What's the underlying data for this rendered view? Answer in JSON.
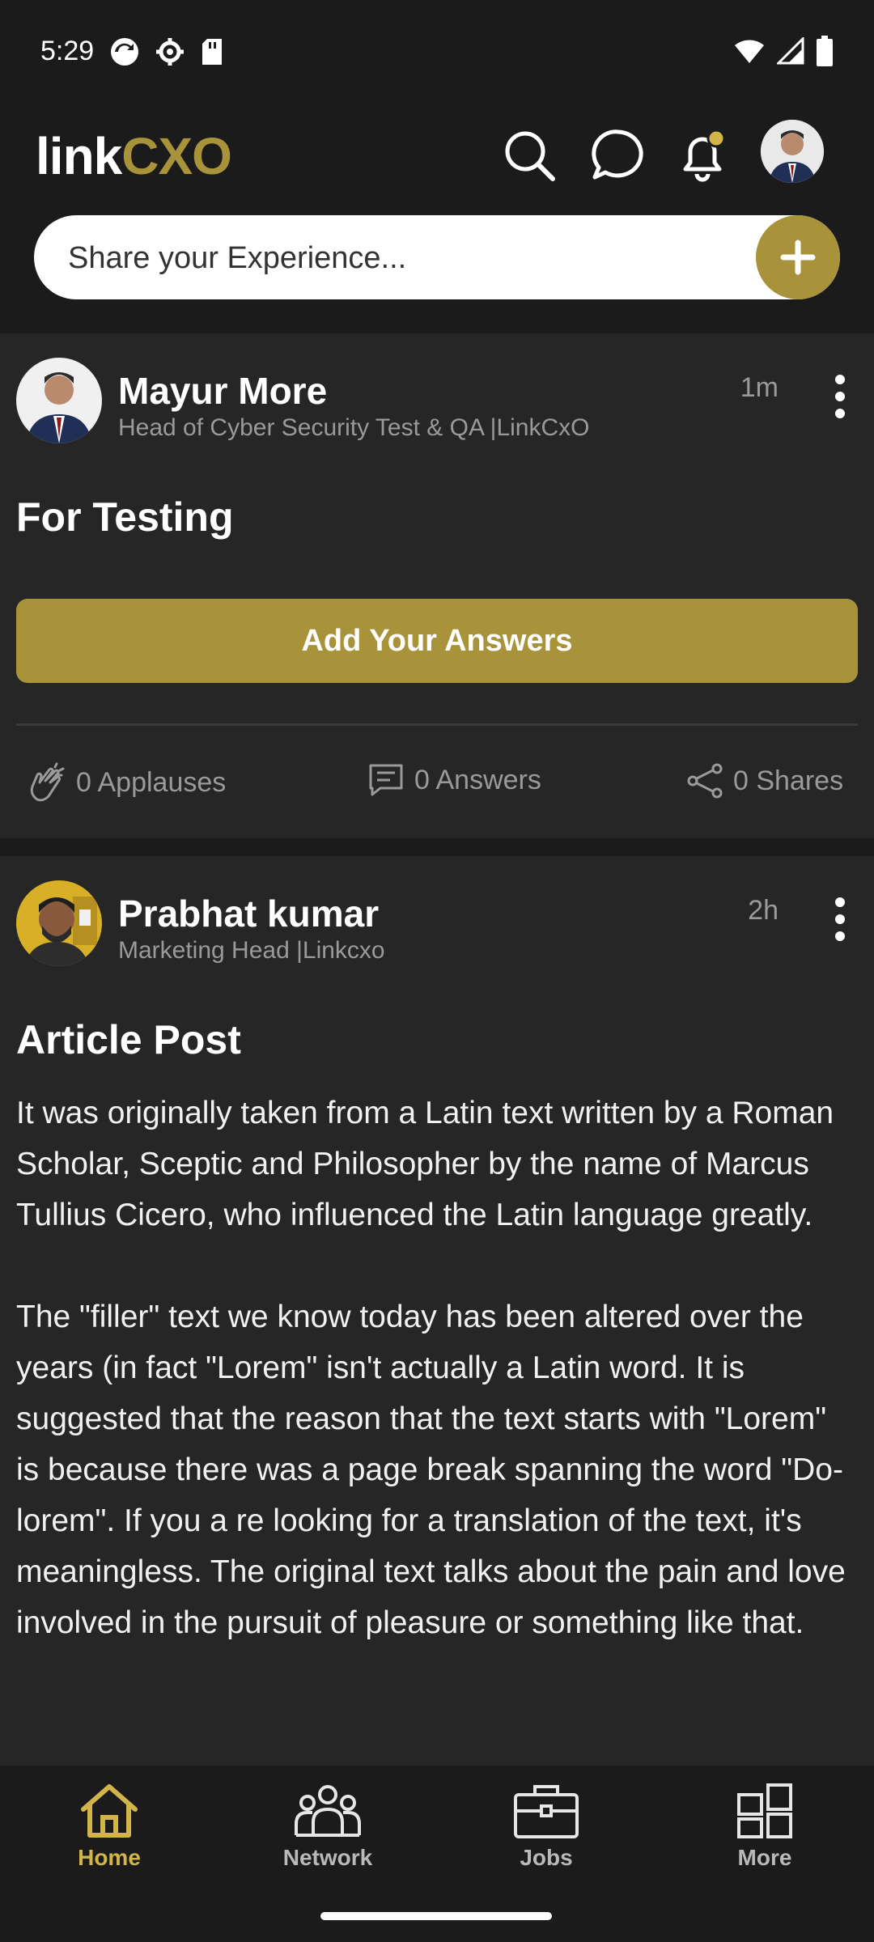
{
  "status_bar": {
    "time": "5:29",
    "icons_left": [
      "sync-icon",
      "settings-icon",
      "sd-card-icon"
    ],
    "icons_right": [
      "wifi-icon",
      "signal-icon",
      "battery-icon"
    ]
  },
  "header": {
    "logo_link": "link",
    "logo_cxo": "CXO",
    "icons": [
      "search-icon",
      "chat-icon",
      "notification-bell-icon",
      "profile-avatar"
    ],
    "accent_color": "#a8923a"
  },
  "composer": {
    "placeholder": "Share your Experience..."
  },
  "posts": [
    {
      "author": "Mayur More",
      "role": "Head of Cyber Security Test & QA |LinkCxO",
      "time": "1m",
      "title": "For Testing",
      "action_button": "Add Your Answers",
      "stats": {
        "applause": "0 Applauses",
        "answers": "0 Answers",
        "shares": "0 Shares"
      }
    },
    {
      "author": "Prabhat kumar",
      "role": "Marketing Head |Linkcxo",
      "time": "2h",
      "title": "Article Post",
      "paragraphs": [
        "It was originally taken from a Latin text written by a Roman Scholar, Sceptic and Philosopher by the name of Marcus Tullius Cicero, who influenced the Latin language greatly.",
        "The \"filler\" text we know today has been altered over the years (in fact \"Lorem\" isn't actually a Latin word. It is suggested that the reason that the text starts with \"Lorem\" is because there was a page break spanning the word \"Do-lorem\". If you a re looking for a translation of the text, it's meaningless. The original text talks about the pain and love involved in the pursuit of pleasure or something like that."
      ]
    }
  ],
  "bottom_nav": {
    "items": [
      {
        "label": "Home",
        "icon": "home-icon",
        "active": true
      },
      {
        "label": "Network",
        "icon": "network-icon",
        "active": false
      },
      {
        "label": "Jobs",
        "icon": "briefcase-icon",
        "active": false
      },
      {
        "label": "More",
        "icon": "grid-icon",
        "active": false
      }
    ]
  }
}
